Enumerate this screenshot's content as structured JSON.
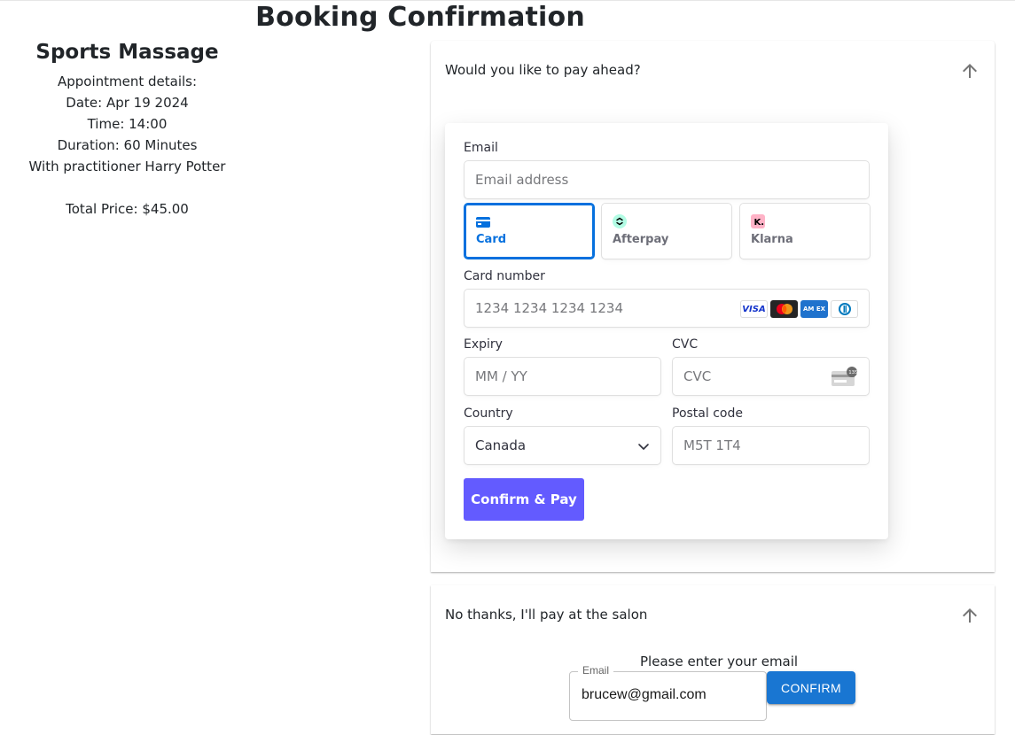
{
  "page": {
    "title": "Booking Confirmation"
  },
  "summary": {
    "service": "Sports Massage",
    "details_heading": "Appointment details:",
    "date": "Date: Apr 19 2024",
    "time": "Time: 14:00",
    "duration": "Duration: 60 Minutes",
    "practitioner": "With practitioner Harry Potter",
    "total": "Total Price: $45.00"
  },
  "pay_ahead": {
    "heading": "Would you like to pay ahead?",
    "arrow_icon": "arrow-up-icon",
    "email_label": "Email",
    "email_placeholder": "Email address",
    "methods": [
      {
        "label": "Card",
        "icon": "credit-card-icon",
        "selected": true,
        "color": "#0570de"
      },
      {
        "label": "Afterpay",
        "icon": "afterpay-icon",
        "selected": false,
        "color": "#b2fce4"
      },
      {
        "label": "Klarna",
        "icon": "klarna-icon",
        "selected": false,
        "color": "#ffb3c7"
      }
    ],
    "card_number_label": "Card number",
    "card_number_placeholder": "1234 1234 1234 1234",
    "card_brands": [
      "visa",
      "mastercard",
      "amex",
      "diners"
    ],
    "visa_text": "VISA",
    "amex_text": "AM EX",
    "expiry_label": "Expiry",
    "expiry_placeholder": "MM / YY",
    "cvc_label": "CVC",
    "cvc_placeholder": "CVC",
    "cvc_badge": "135",
    "country_label": "Country",
    "country_value": "Canada",
    "postal_label": "Postal code",
    "postal_placeholder": "M5T 1T4",
    "pay_button": "Confirm & Pay",
    "pay_button_color": "#635bff"
  },
  "pay_at_salon": {
    "heading": "No thanks, I'll pay at the salon",
    "arrow_icon": "arrow-up-icon",
    "prompt": "Please enter your email",
    "email_label": "Email",
    "email_value": "brucew@gmail.com",
    "confirm_button": "CONFIRM",
    "confirm_button_color": "#1976d2"
  }
}
